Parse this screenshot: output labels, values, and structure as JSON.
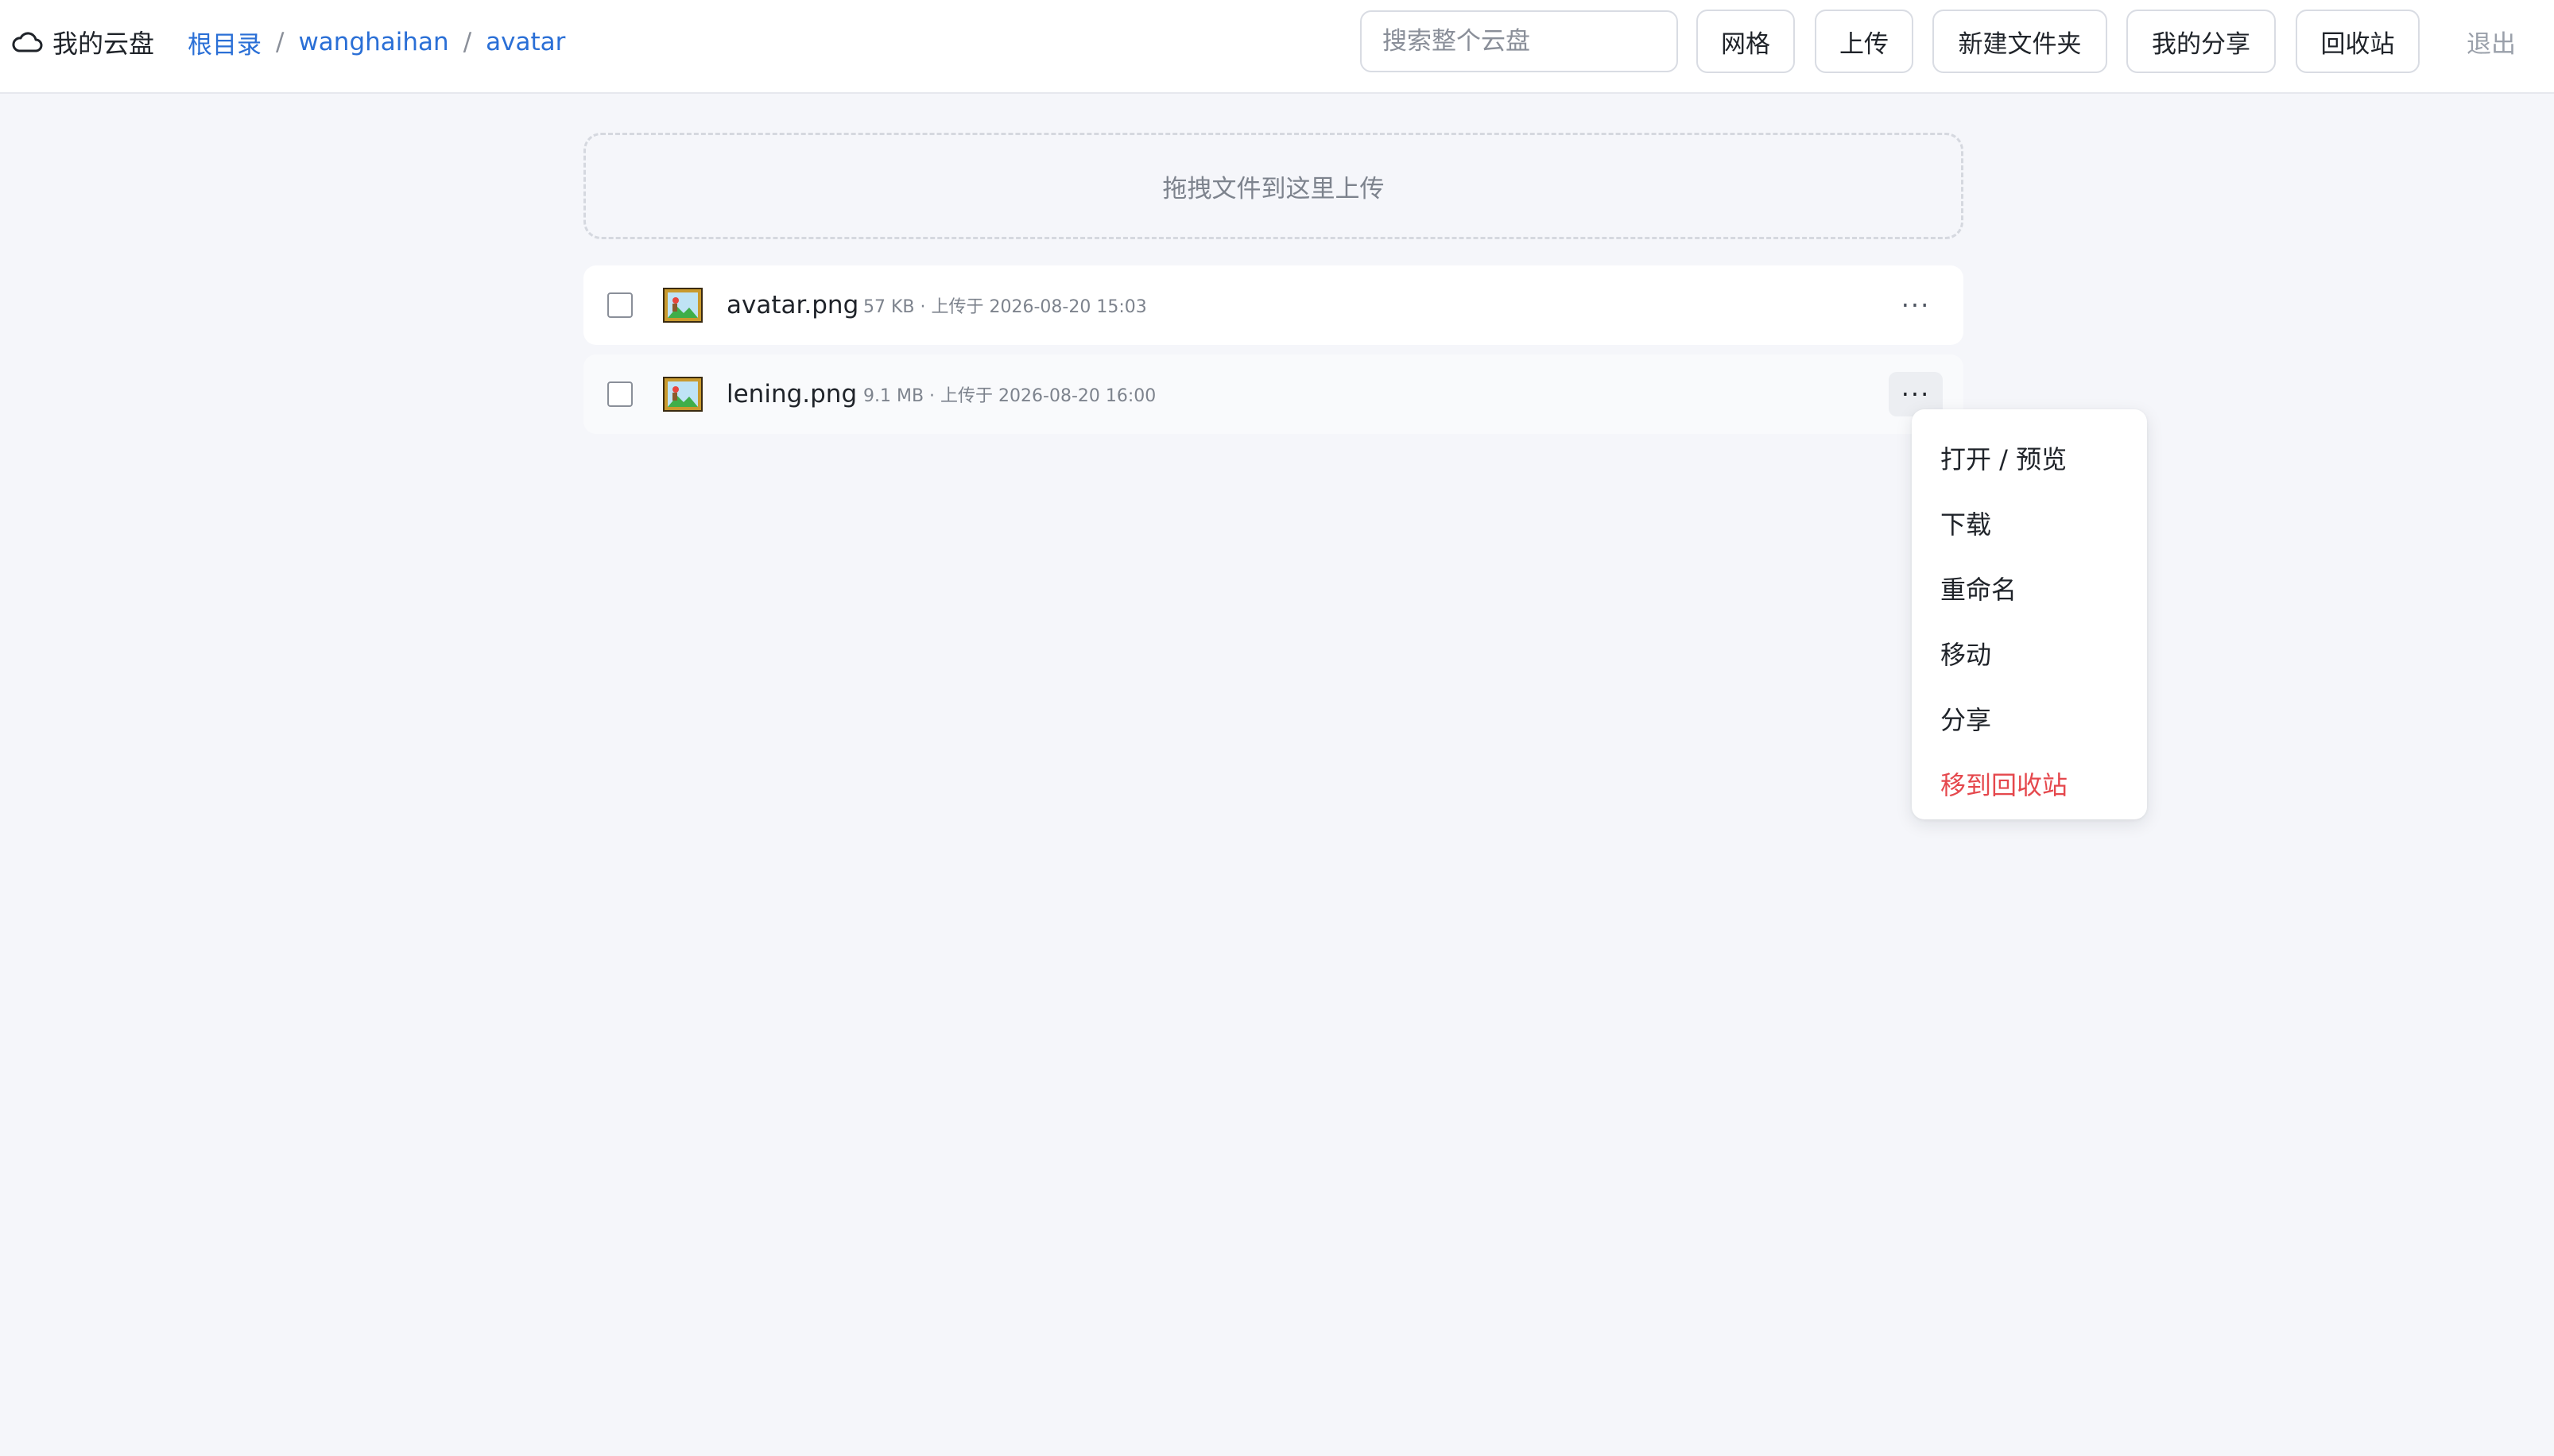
{
  "header": {
    "brand_title": "我的云盘",
    "breadcrumb": [
      "根目录",
      "wanghaihan",
      "avatar"
    ],
    "breadcrumb_separator": "/",
    "search_placeholder": "搜索整个云盘",
    "buttons": {
      "grid": "网格",
      "upload": "上传",
      "new_folder": "新建文件夹",
      "my_shares": "我的分享",
      "recycle_bin": "回收站"
    },
    "logout": "退出"
  },
  "dropzone": {
    "text": "拖拽文件到这里上传"
  },
  "files": [
    {
      "name": "avatar.png",
      "meta": "57 KB · 上传于 2026-08-20 15:03",
      "icon": "image-file-icon"
    },
    {
      "name": "lening.png",
      "meta": "9.1 MB · 上传于 2026-08-20 16:00",
      "icon": "image-file-icon"
    }
  ],
  "more_label": "···",
  "context_menu": {
    "items": [
      "打开 / 预览",
      "下载",
      "重命名",
      "移动",
      "分享",
      "移到回收站"
    ]
  },
  "colors": {
    "link": "#2a6fd6",
    "danger": "#e5484d",
    "background": "#f5f6fa"
  }
}
